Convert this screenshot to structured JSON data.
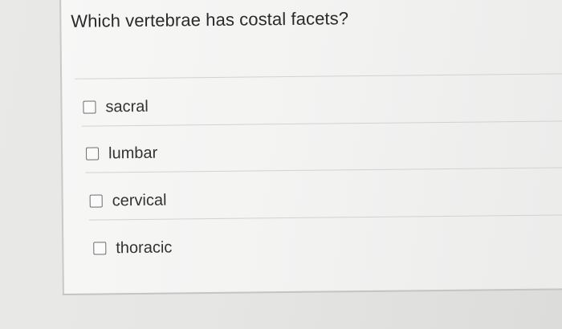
{
  "question": {
    "text": "Which vertebrae has costal facets?"
  },
  "options": [
    {
      "label": "sacral",
      "checked": false
    },
    {
      "label": "lumbar",
      "checked": false
    },
    {
      "label": "cervical",
      "checked": false
    },
    {
      "label": "thoracic",
      "checked": false
    }
  ]
}
